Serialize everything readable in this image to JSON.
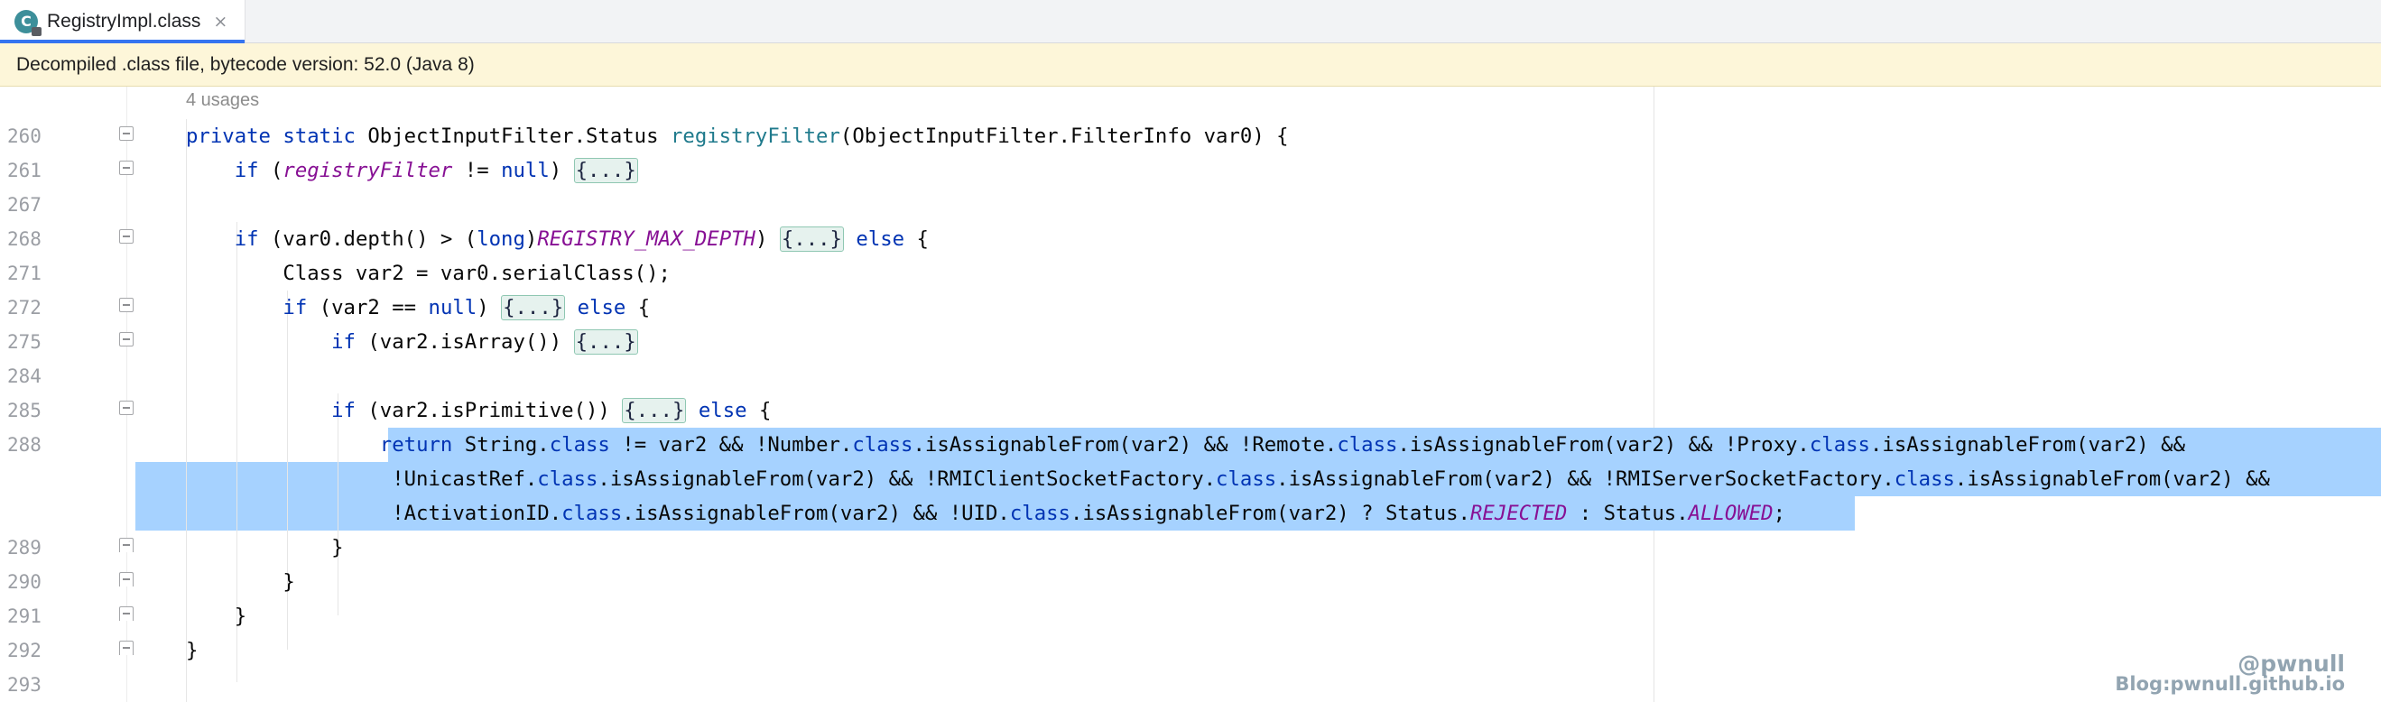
{
  "tab": {
    "icon_letter": "C",
    "title": "RegistryImpl.class",
    "close_glyph": "×"
  },
  "banner": {
    "text": "Decompiled .class file, bytecode version: 52.0 (Java 8)"
  },
  "editor": {
    "usages_hint": "4 usages",
    "lines": [
      {
        "num": "260",
        "tokens": [
          {
            "t": "private static ",
            "c": "kw"
          },
          {
            "t": "ObjectInputFilter.Status "
          },
          {
            "t": "registryFilter",
            "c": "ty"
          },
          {
            "t": "(ObjectInputFilter.FilterInfo var0) {"
          }
        ]
      },
      {
        "num": "261",
        "tokens": [
          {
            "t": "    "
          },
          {
            "t": "if ",
            "c": "kw"
          },
          {
            "t": "("
          },
          {
            "t": "registryFilter",
            "c": "fld"
          },
          {
            "t": " != "
          },
          {
            "t": "null",
            "c": "kw"
          },
          {
            "t": ") "
          },
          {
            "t": "{...}",
            "c": "ph"
          }
        ]
      },
      {
        "num": "267",
        "tokens": []
      },
      {
        "num": "268",
        "tokens": [
          {
            "t": "    "
          },
          {
            "t": "if ",
            "c": "kw"
          },
          {
            "t": "(var0.depth() > ("
          },
          {
            "t": "long",
            "c": "kw"
          },
          {
            "t": ")"
          },
          {
            "t": "REGISTRY_MAX_DEPTH",
            "c": "fld"
          },
          {
            "t": ") "
          },
          {
            "t": "{...}",
            "c": "ph"
          },
          {
            "t": " "
          },
          {
            "t": "else",
            "c": "kw"
          },
          {
            "t": " {"
          }
        ]
      },
      {
        "num": "271",
        "tokens": [
          {
            "t": "        Class var2 = var0.serialClass();"
          }
        ]
      },
      {
        "num": "272",
        "tokens": [
          {
            "t": "        "
          },
          {
            "t": "if ",
            "c": "kw"
          },
          {
            "t": "(var2 == "
          },
          {
            "t": "null",
            "c": "kw"
          },
          {
            "t": ") "
          },
          {
            "t": "{...}",
            "c": "ph"
          },
          {
            "t": " "
          },
          {
            "t": "else",
            "c": "kw"
          },
          {
            "t": " {"
          }
        ]
      },
      {
        "num": "275",
        "tokens": [
          {
            "t": "            "
          },
          {
            "t": "if ",
            "c": "kw"
          },
          {
            "t": "(var2.isArray()) "
          },
          {
            "t": "{...}",
            "c": "ph"
          }
        ]
      },
      {
        "num": "284",
        "tokens": []
      },
      {
        "num": "285",
        "tokens": [
          {
            "t": "            "
          },
          {
            "t": "if ",
            "c": "kw"
          },
          {
            "t": "(var2.isPrimitive()) "
          },
          {
            "t": "{...}",
            "c": "ph"
          },
          {
            "t": " "
          },
          {
            "t": "else",
            "c": "kw"
          },
          {
            "t": " {"
          }
        ]
      },
      {
        "num": "288",
        "tokens": [
          {
            "t": "                "
          },
          {
            "t": "return ",
            "c": "kw"
          },
          {
            "t": "String."
          },
          {
            "t": "class",
            "c": "kw"
          },
          {
            "t": " != var2 && !Number."
          },
          {
            "t": "class",
            "c": "kw"
          },
          {
            "t": ".isAssignableFrom(var2) && !Remote."
          },
          {
            "t": "class",
            "c": "kw"
          },
          {
            "t": ".isAssignableFrom(var2) && !Proxy."
          },
          {
            "t": "class",
            "c": "kw"
          },
          {
            "t": ".isAssignableFrom(var2) &&"
          }
        ]
      },
      {
        "num": "",
        "tokens": [
          {
            "t": "                 !UnicastRef."
          },
          {
            "t": "class",
            "c": "kw"
          },
          {
            "t": ".isAssignableFrom(var2) && !RMIClientSocketFactory."
          },
          {
            "t": "class",
            "c": "kw"
          },
          {
            "t": ".isAssignableFrom(var2) && !RMIServerSocketFactory."
          },
          {
            "t": "class",
            "c": "kw"
          },
          {
            "t": ".isAssignableFrom(var2) &&"
          }
        ]
      },
      {
        "num": "",
        "tokens": [
          {
            "t": "                 !ActivationID."
          },
          {
            "t": "class",
            "c": "kw"
          },
          {
            "t": ".isAssignableFrom(var2) && !UID."
          },
          {
            "t": "class",
            "c": "kw"
          },
          {
            "t": ".isAssignableFrom(var2) ? Status."
          },
          {
            "t": "REJECTED",
            "c": "fld"
          },
          {
            "t": " : Status."
          },
          {
            "t": "ALLOWED",
            "c": "fld"
          },
          {
            "t": ";"
          }
        ]
      },
      {
        "num": "289",
        "tokens": [
          {
            "t": "            }"
          }
        ]
      },
      {
        "num": "290",
        "tokens": [
          {
            "t": "        }"
          }
        ]
      },
      {
        "num": "291",
        "tokens": [
          {
            "t": "    }"
          }
        ]
      },
      {
        "num": "292",
        "tokens": [
          {
            "t": "}"
          }
        ]
      },
      {
        "num": "293",
        "tokens": []
      }
    ]
  },
  "watermark": {
    "handle": "@pwnull",
    "blog": "Blog:pwnull.github.io"
  },
  "colors": {
    "keyword": "#0033b3",
    "method_decl": "#1f7a8c",
    "static_field": "#871094",
    "selection": "#a6d2ff",
    "banner_bg": "#fdf6d9",
    "tab_accent": "#3574f0"
  },
  "icons": {
    "tab_icon": "java-class-icon",
    "fold_marker": "fold-minus-icon"
  }
}
